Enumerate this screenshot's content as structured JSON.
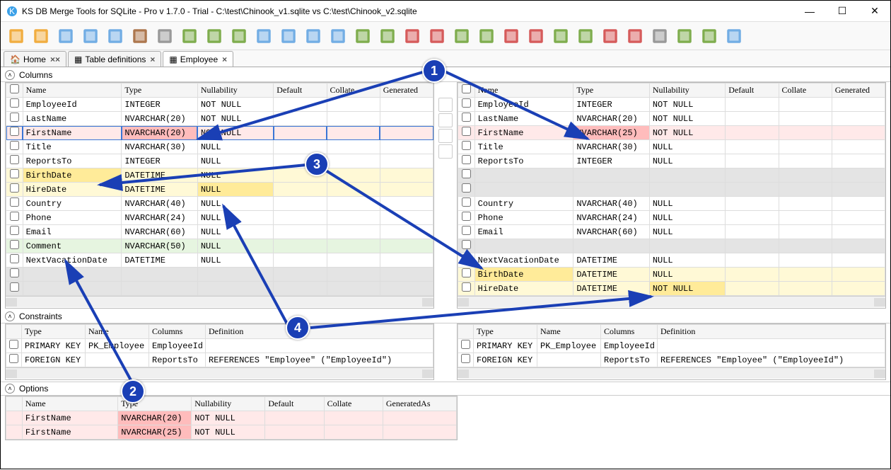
{
  "window": {
    "title": "KS DB Merge Tools for SQLite - Pro v 1.7.0 - Trial - C:\\test\\Chinook_v1.sqlite vs C:\\test\\Chinook_v2.sqlite"
  },
  "tabs": {
    "home": "Home",
    "tdef": "Table definitions",
    "emp": "Employee"
  },
  "sections": {
    "columns": "Columns",
    "constraints": "Constraints",
    "options": "Options"
  },
  "hdr": {
    "name": "Name",
    "type": "Type",
    "null": "Nullability",
    "def": "Default",
    "coll": "Collate",
    "gen": "GeneratedAs",
    "genS": "Generated",
    "cols": "Columns",
    "definition": "Definition"
  },
  "left": {
    "rows": [
      {
        "n": "EmployeeId",
        "t": "INTEGER",
        "u": "NOT NULL"
      },
      {
        "n": "LastName",
        "t": "NVARCHAR(20)",
        "u": "NOT NULL"
      },
      {
        "n": "FirstName",
        "t": "NVARCHAR(20)",
        "u": "NOT NULL",
        "cls": "row-diff sel",
        "hl": "t"
      },
      {
        "n": "Title",
        "t": "NVARCHAR(30)",
        "u": "NULL"
      },
      {
        "n": "ReportsTo",
        "t": "INTEGER",
        "u": "NULL"
      },
      {
        "n": "BirthDate",
        "t": "DATETIME",
        "u": "NULL",
        "cls": "row-moved",
        "hl": "n"
      },
      {
        "n": "HireDate",
        "t": "DATETIME",
        "u": "NULL",
        "cls": "row-moved",
        "hl": "u"
      },
      {
        "n": "Country",
        "t": "NVARCHAR(40)",
        "u": "NULL"
      },
      {
        "n": "Phone",
        "t": "NVARCHAR(24)",
        "u": "NULL"
      },
      {
        "n": "Email",
        "t": "NVARCHAR(60)",
        "u": "NULL"
      },
      {
        "n": "Comment",
        "t": "NVARCHAR(50)",
        "u": "NULL",
        "cls": "row-added"
      },
      {
        "n": "NextVacationDate",
        "t": "DATETIME",
        "u": "NULL"
      },
      {
        "gap": true
      },
      {
        "gap": true
      }
    ]
  },
  "right": {
    "rows": [
      {
        "n": "EmployeeId",
        "t": "INTEGER",
        "u": "NOT NULL"
      },
      {
        "n": "LastName",
        "t": "NVARCHAR(20)",
        "u": "NOT NULL"
      },
      {
        "n": "FirstName",
        "t": "NVARCHAR(25)",
        "u": "NOT NULL",
        "cls": "row-diff",
        "hl": "t"
      },
      {
        "n": "Title",
        "t": "NVARCHAR(30)",
        "u": "NULL"
      },
      {
        "n": "ReportsTo",
        "t": "INTEGER",
        "u": "NULL"
      },
      {
        "gap": true
      },
      {
        "gap": true
      },
      {
        "n": "Country",
        "t": "NVARCHAR(40)",
        "u": "NULL"
      },
      {
        "n": "Phone",
        "t": "NVARCHAR(24)",
        "u": "NULL"
      },
      {
        "n": "Email",
        "t": "NVARCHAR(60)",
        "u": "NULL"
      },
      {
        "gap": true
      },
      {
        "n": "NextVacationDate",
        "t": "DATETIME",
        "u": "NULL"
      },
      {
        "n": "BirthDate",
        "t": "DATETIME",
        "u": "NULL",
        "cls": "row-moved",
        "hl": "n"
      },
      {
        "n": "HireDate",
        "t": "DATETIME",
        "u": "NOT NULL",
        "cls": "row-moved",
        "hl": "u"
      }
    ]
  },
  "conL": [
    {
      "t": "PRIMARY KEY",
      "n": "PK_Employee",
      "c": "EmployeeId",
      "d": ""
    },
    {
      "t": "FOREIGN KEY",
      "n": "",
      "c": "ReportsTo",
      "d": "REFERENCES \"Employee\" (\"EmployeeId\")"
    }
  ],
  "conR": [
    {
      "t": "PRIMARY KEY",
      "n": "PK_Employee",
      "c": "EmployeeId",
      "d": ""
    },
    {
      "t": "FOREIGN KEY",
      "n": "",
      "c": "ReportsTo",
      "d": "REFERENCES \"Employee\" (\"EmployeeId\")"
    }
  ],
  "opts": [
    {
      "n": "FirstName",
      "t": "NVARCHAR(20)",
      "u": "NOT NULL"
    },
    {
      "n": "FirstName",
      "t": "NVARCHAR(25)",
      "u": "NOT NULL"
    }
  ],
  "callouts": {
    "c1": "1",
    "c2": "2",
    "c3": "3",
    "c4": "4"
  }
}
